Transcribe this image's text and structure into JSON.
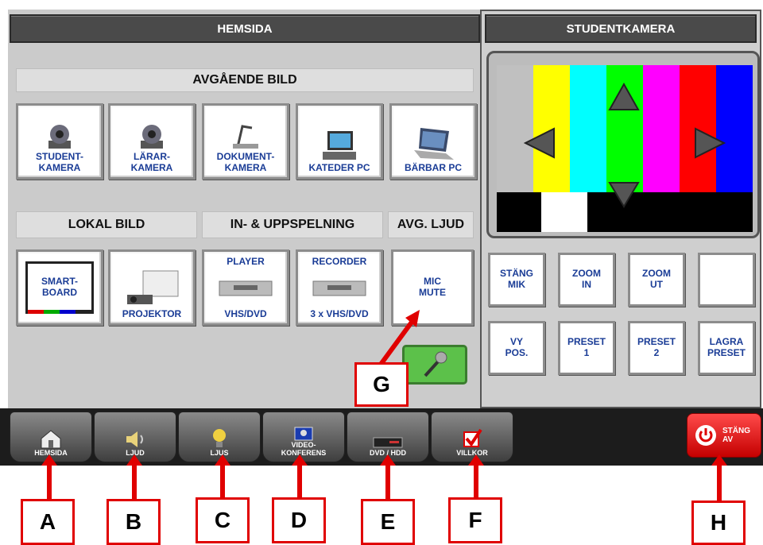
{
  "home_panel": {
    "title": "HEMSIDA",
    "sections": {
      "outgoing": "AVGÅENDE BILD",
      "local": "LOKAL BILD",
      "playback": "IN- & UPPSPELNING",
      "audio": "AVG. LJUD"
    },
    "sources": [
      {
        "label": "STUDENT-\nKAMERA",
        "icon": "ptz-camera-icon"
      },
      {
        "label": "LÄRAR-\nKAMERA",
        "icon": "ptz-camera-icon"
      },
      {
        "label": "DOKUMENT-\nKAMERA",
        "icon": "document-camera-icon"
      },
      {
        "label": "KATEDER PC",
        "icon": "desktop-pc-icon"
      },
      {
        "label": "BÄRBAR PC",
        "icon": "laptop-icon"
      }
    ],
    "local_sources": [
      {
        "label": "SMART-\nBOARD",
        "icon": "smartboard-icon"
      },
      {
        "label": "PROJEKTOR",
        "icon": "projector-icon"
      }
    ],
    "playback_devices": [
      {
        "label_top": "PLAYER",
        "label_bottom": "VHS/DVD",
        "icon": "vcr-icon"
      },
      {
        "label_top": "RECORDER",
        "label_bottom": "3 x VHS/DVD",
        "icon": "vcr-icon"
      }
    ],
    "mic_mute": "MIC\nMUTE"
  },
  "camera_panel": {
    "title": "STUDENTKAMERA",
    "colors": [
      "#c0c0c0",
      "#ffff00",
      "#00ffff",
      "#00ff00",
      "#ff00ff",
      "#ff0000",
      "#0000ff"
    ],
    "controls_row1": [
      "STÄNG\nMIK",
      "ZOOM\nIN",
      "ZOOM\nUT",
      ""
    ],
    "controls_row2": [
      "VY\nPOS.",
      "PRESET\n1",
      "PRESET\n2",
      "LAGRA\nPRESET"
    ]
  },
  "nav": [
    {
      "label": "HEMSIDA",
      "icon": "house-icon"
    },
    {
      "label": "LJUD",
      "icon": "speaker-icon"
    },
    {
      "label": "LJUS",
      "icon": "lightbulb-icon"
    },
    {
      "label": "VIDEO-\nKONFERENS",
      "icon": "video-conference-icon"
    },
    {
      "label": "DVD / HDD",
      "icon": "dvd-player-icon"
    },
    {
      "label": "VILLKOR",
      "icon": "checkbox-icon"
    }
  ],
  "power_button": "STÄNG\nAV",
  "callouts": [
    "A",
    "B",
    "C",
    "D",
    "E",
    "F",
    "G",
    "H"
  ]
}
